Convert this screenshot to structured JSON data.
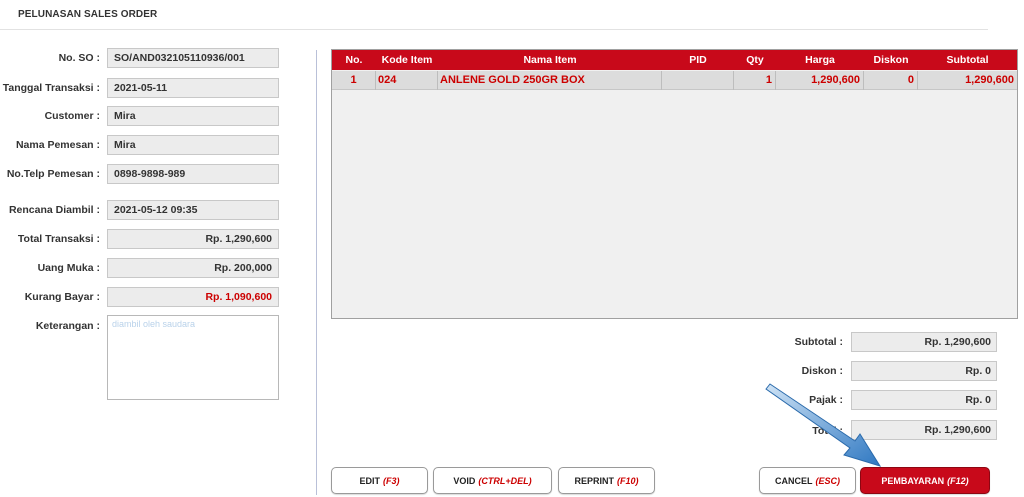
{
  "page": {
    "title": "PELUNASAN SALES ORDER"
  },
  "form": {
    "no_so": {
      "label": "No. SO :",
      "value": "SO/AND032105110936/001"
    },
    "tanggal_transaksi": {
      "label": "Tanggal Transaksi :",
      "value": "2021-05-11"
    },
    "customer": {
      "label": "Customer :",
      "value": "Mira"
    },
    "nama_pemesan": {
      "label": "Nama Pemesan :",
      "value": "Mira"
    },
    "no_telp_pemesan": {
      "label": "No.Telp Pemesan :",
      "value": "0898-9898-989"
    },
    "rencana_diambil": {
      "label": "Rencana Diambil :",
      "value": "2021-05-12 09:35"
    },
    "total_transaksi": {
      "label": "Total Transaksi :",
      "value": "Rp. 1,290,600"
    },
    "uang_muka": {
      "label": "Uang Muka :",
      "value": "Rp. 200,000"
    },
    "kurang_bayar": {
      "label": "Kurang Bayar :",
      "value": "Rp. 1,090,600"
    },
    "keterangan": {
      "label": "Keterangan :",
      "placeholder": "diambil oleh saudara"
    }
  },
  "grid": {
    "columns": [
      "No.",
      "Kode Item",
      "Nama Item",
      "PID",
      "Qty",
      "Harga",
      "Diskon",
      "Subtotal"
    ],
    "rows": [
      {
        "no": "1",
        "kode_item": "024",
        "nama_item": "ANLENE GOLD 250GR BOX",
        "pid": "",
        "qty": "1",
        "harga": "1,290,600",
        "diskon": "0",
        "subtotal": "1,290,600"
      }
    ]
  },
  "totals": {
    "subtotal": {
      "label": "Subtotal :",
      "value": "Rp. 1,290,600"
    },
    "diskon": {
      "label": "Diskon :",
      "value": "Rp. 0"
    },
    "pajak": {
      "label": "Pajak :",
      "value": "Rp. 0"
    },
    "total": {
      "label": "Total :",
      "value": "Rp. 1,290,600"
    }
  },
  "buttons": {
    "edit": {
      "label": "EDIT",
      "key": "(F3)"
    },
    "void": {
      "label": "VOID",
      "key": "(CTRL+DEL)"
    },
    "reprint": {
      "label": "REPRINT",
      "key": "(F10)"
    },
    "cancel": {
      "label": "CANCEL",
      "key": "(ESC)"
    },
    "pembayaran": {
      "label": "PEMBAYARAN",
      "key": "(F12)"
    }
  },
  "colors": {
    "accent": "#c8091a",
    "value_red": "#cc0000",
    "arrow": "#3a7ec4"
  },
  "icons": {
    "annotation": "arrow-pointer-icon"
  }
}
